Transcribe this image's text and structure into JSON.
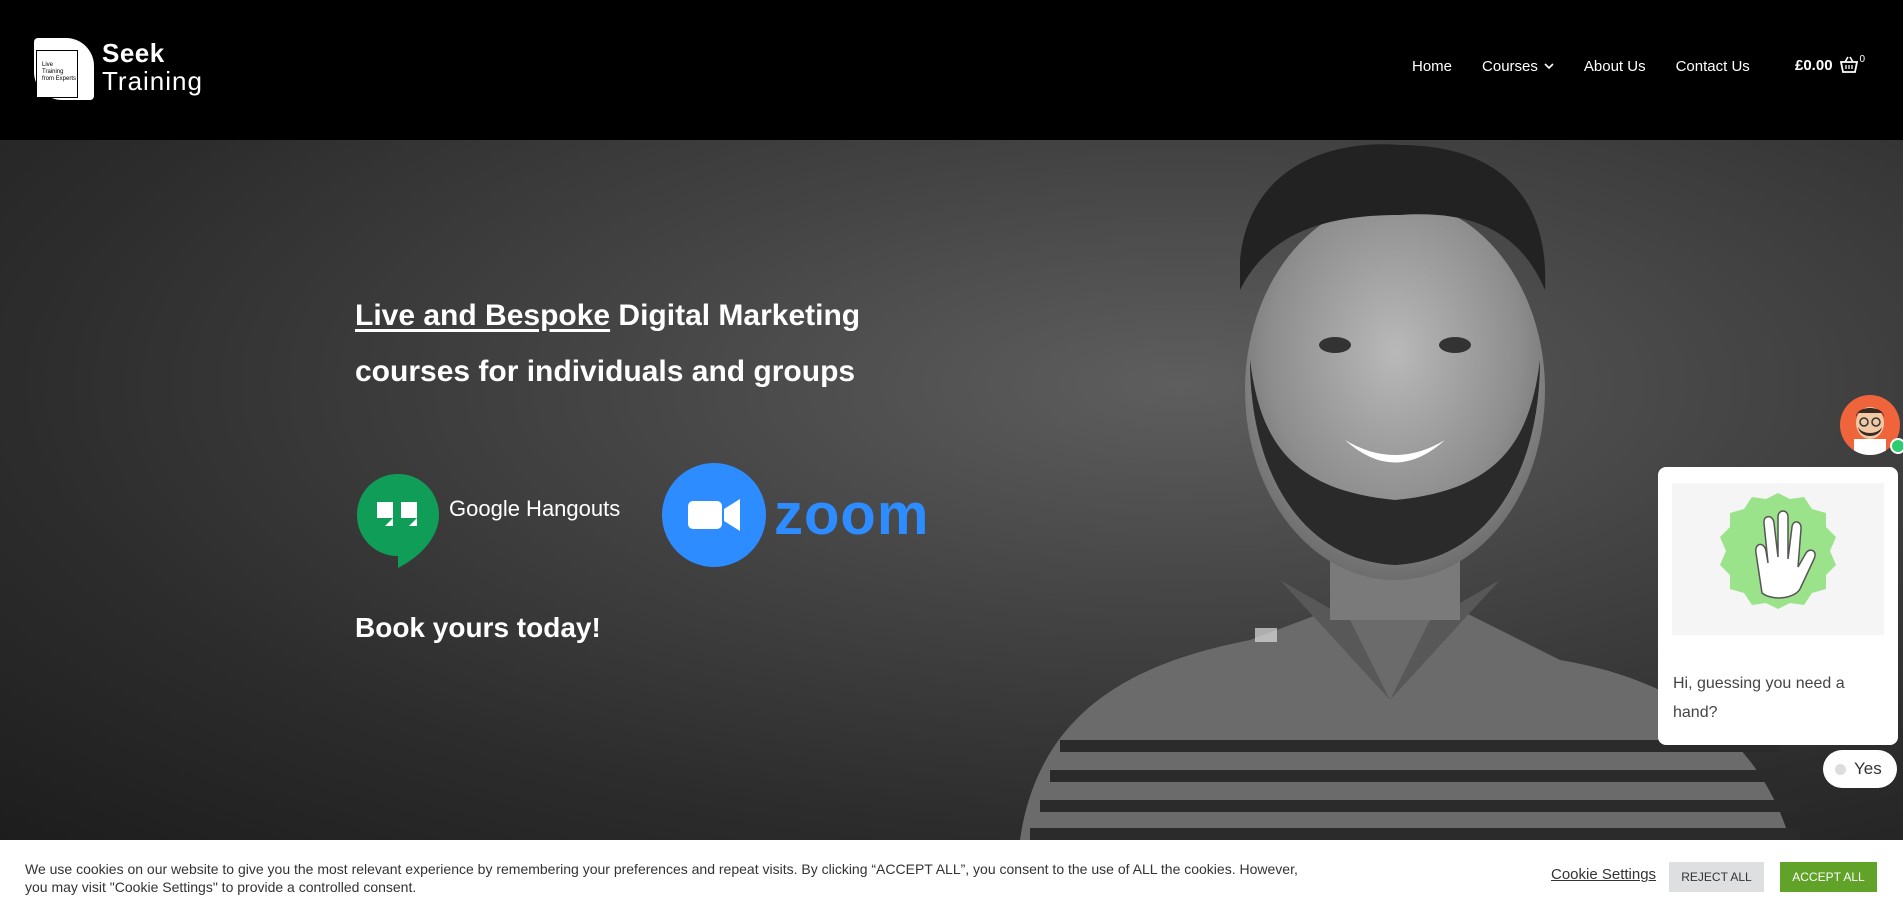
{
  "header": {
    "logo": {
      "word1": "Seek",
      "word2": "Training",
      "tagline": "Live Training from Experts"
    },
    "nav": [
      {
        "label": "Home"
      },
      {
        "label": "Courses"
      },
      {
        "label": "About Us"
      },
      {
        "label": "Contact Us"
      }
    ],
    "cart": {
      "total": "£0.00",
      "count": "0"
    }
  },
  "hero": {
    "title_underlined": "Live and Bespoke",
    "title_rest": " Digital Marketing courses for individuals and groups",
    "hangouts_label": "Google Hangouts",
    "zoom_label": "zoom",
    "cta": "Book yours today!"
  },
  "chat": {
    "message": "Hi, guessing you need a hand?",
    "reply_option": "Yes"
  },
  "cookie": {
    "text": "We use cookies on our website to give you the most relevant experience by remembering your preferences and repeat visits. By clicking “ACCEPT ALL”, you consent to the use of ALL the cookies. However, you may visit \"Cookie Settings\" to provide a controlled consent.",
    "settings_label": "Cookie Settings",
    "reject_label": "REJECT ALL",
    "accept_label": "ACCEPT ALL"
  },
  "colors": {
    "header_bg": "#000000",
    "zoom_blue": "#2d8cff",
    "hangouts_green": "#0f9d58",
    "accept_green": "#61a229",
    "chat_avatar_bg": "#f0643c"
  }
}
